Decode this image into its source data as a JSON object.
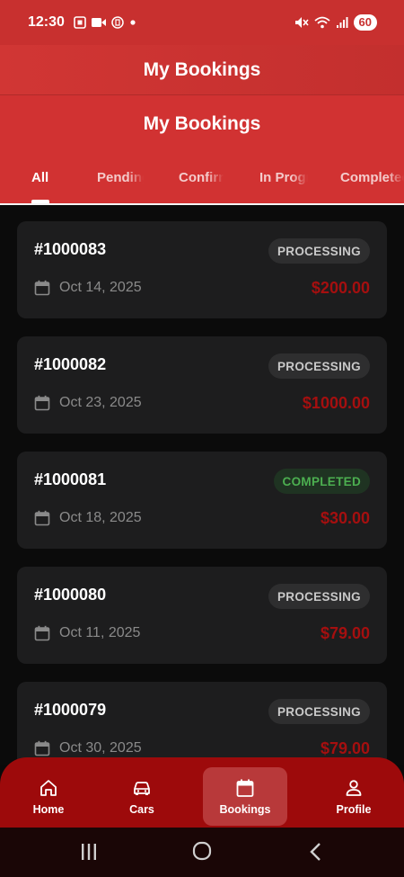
{
  "status_bar": {
    "time": "12:30",
    "battery": "60",
    "icons": [
      "screenshot-icon",
      "video-icon",
      "shield-icon",
      "dot-icon",
      "mute-icon",
      "wifi-icon",
      "signal-icon"
    ]
  },
  "app_bar": {
    "title": "My Bookings"
  },
  "header": {
    "title": "My Bookings",
    "tabs": [
      {
        "label": "All",
        "active": true
      },
      {
        "label": "Pending"
      },
      {
        "label": "Confirmed"
      },
      {
        "label": "In Progress"
      },
      {
        "label": "Completed"
      }
    ]
  },
  "bookings": [
    {
      "id": "#1000083",
      "status": "PROCESSING",
      "date": "Oct 14, 2025",
      "price": "$200.00"
    },
    {
      "id": "#1000082",
      "status": "PROCESSING",
      "date": "Oct 23, 2025",
      "price": "$1000.00"
    },
    {
      "id": "#1000081",
      "status": "COMPLETED",
      "date": "Oct 18, 2025",
      "price": "$30.00"
    },
    {
      "id": "#1000080",
      "status": "PROCESSING",
      "date": "Oct 11, 2025",
      "price": "$79.00"
    },
    {
      "id": "#1000079",
      "status": "PROCESSING",
      "date": "Oct 30, 2025",
      "price": "$79.00"
    }
  ],
  "bottom_nav": [
    {
      "label": "Home",
      "icon": "home-icon"
    },
    {
      "label": "Cars",
      "icon": "car-icon"
    },
    {
      "label": "Bookings",
      "icon": "calendar-icon",
      "active": true
    },
    {
      "label": "Profile",
      "icon": "person-icon"
    }
  ],
  "system_nav": [
    "recents-icon",
    "home-circle-icon",
    "back-icon"
  ],
  "colors": {
    "accent": "#d13232",
    "price": "#a50f0f",
    "completed": "#4caf50",
    "nav": "#9d0a0b"
  }
}
